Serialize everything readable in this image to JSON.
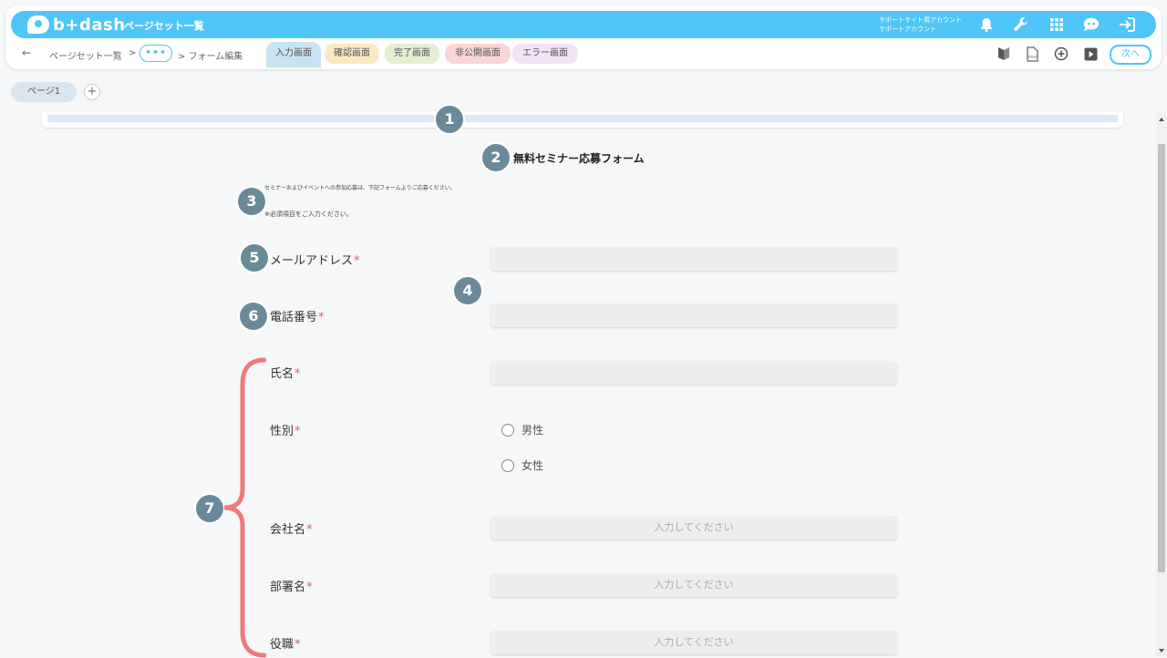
{
  "app": {
    "logo_text": "b+dash",
    "title": "ページセット一覧",
    "account_line1": "サポートサイト用アカウント",
    "account_line2": "サポートアカウント"
  },
  "breadcrumb": {
    "item1": "ページセット一覧",
    "sep1": ">",
    "dots": "•••",
    "sep2": "> フォーム編集"
  },
  "tabs": [
    {
      "label": "入力画面",
      "color": "#c9e3f1"
    },
    {
      "label": "確認画面",
      "color": "#fbe9c3"
    },
    {
      "label": "完了画面",
      "color": "#e4efd3"
    },
    {
      "label": "非公開画面",
      "color": "#f9d6d6"
    },
    {
      "label": "エラー画面",
      "color": "#f3e3f7"
    }
  ],
  "next_button": "次へ",
  "page_tab": "ページ1",
  "add_page": "+",
  "badges": [
    "1",
    "2",
    "3",
    "4",
    "5",
    "6",
    "7"
  ],
  "form": {
    "title": "無料セミナー応募フォーム",
    "desc1": "セミナーおよびイベントへの参加応募は、下記フォームよりご応募ください。",
    "desc2": "※必須項目をご入力ください。",
    "required_mark": "*",
    "fields": [
      {
        "label": "メールアドレス",
        "placeholder": ""
      },
      {
        "label": "電話番号",
        "placeholder": ""
      },
      {
        "label": "氏名",
        "placeholder": ""
      },
      {
        "label": "性別",
        "options": [
          "男性",
          "女性"
        ]
      },
      {
        "label": "会社名",
        "placeholder": "入力してください"
      },
      {
        "label": "部署名",
        "placeholder": "入力してください"
      },
      {
        "label": "役職",
        "placeholder": "入力してください"
      }
    ]
  },
  "colors": {
    "accent": "#4fc6f7",
    "required": "#e05a5a",
    "badge": "#6a8a99",
    "brace": "#f07a7a"
  }
}
